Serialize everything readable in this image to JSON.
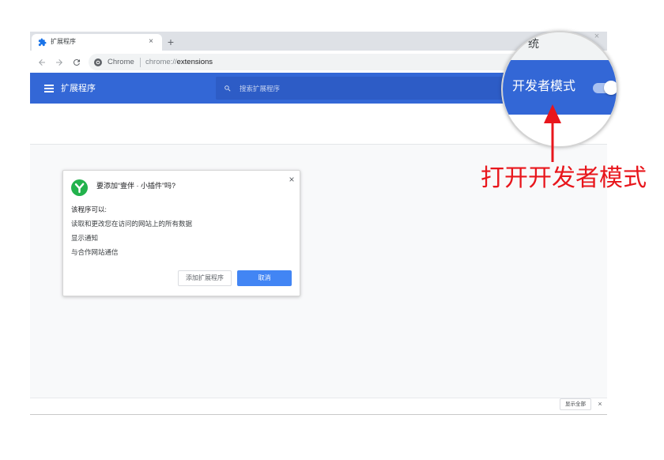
{
  "browser": {
    "tab": {
      "favicon": "puzzle-icon",
      "title": "扩展程序",
      "close": "×"
    },
    "new_tab": "+",
    "window_close": "×",
    "toolbar": {
      "back_icon": "arrow-left-icon",
      "forward_icon": "arrow-right-icon",
      "reload_icon": "reload-icon",
      "site_icon": "chrome-icon",
      "site_label": "Chrome",
      "url_scheme": "chrome://",
      "url_path": "extensions"
    }
  },
  "header": {
    "menu_icon": "hamburger-icon",
    "title": "扩展程序",
    "search_icon": "search-icon",
    "search_placeholder": "搜索扩展程序"
  },
  "dialog": {
    "logo_icon": "extension-logo-icon",
    "title": "要添加“壹伴 · 小插件”吗?",
    "close": "×",
    "intro": "该程序可以:",
    "permissions": [
      "读取和更改您在访问的网站上的所有数据",
      "显示通知",
      "与合作网站通信"
    ],
    "add_button": "添加扩展程序",
    "cancel_button": "取消"
  },
  "download_shelf": {
    "show_all": "显示全部",
    "close": "×"
  },
  "magnifier": {
    "partial_text": "统",
    "developer_mode_label": "开发者模式",
    "developer_mode_on": true
  },
  "annotation": {
    "arrow_icon": "arrow-up-icon",
    "text": "打开开发者模式"
  },
  "colors": {
    "header_blue": "#3367d6",
    "search_blue": "#2d5cc6",
    "button_blue": "#4285f4",
    "logo_green": "#22b24c",
    "annotation_red": "#e8161c",
    "content_grey": "#f8f9fa",
    "tabstrip_grey": "#dee1e6",
    "toggle_track": "#a9c1f0"
  }
}
